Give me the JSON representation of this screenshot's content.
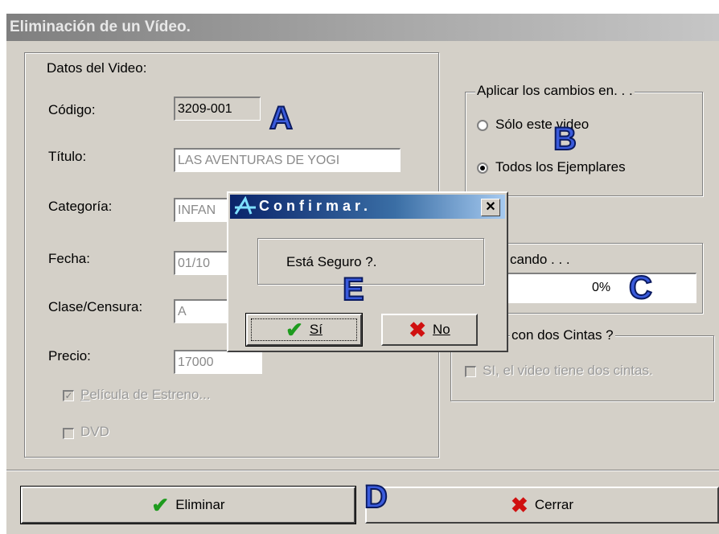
{
  "window": {
    "title": "Eliminación de un Vídeo."
  },
  "video_group": {
    "heading": "Datos del Video:",
    "codigo_label": "Código:",
    "codigo_value": "3209-001",
    "titulo_label": "Título:",
    "titulo_value": "LAS AVENTURAS DE YOGI",
    "categoria_label": "Categoría:",
    "categoria_value": "INFAN",
    "fecha_label": "Fecha:",
    "fecha_value": "01/10",
    "clase_label": "Clase/Censura:",
    "clase_value": "A",
    "precio_label": "Precio:",
    "precio_value": "17000",
    "estreno_label": "Película de Estreno...",
    "estreno_checked": true,
    "dvd_label": "DVD",
    "dvd_checked": false
  },
  "apply_group": {
    "legend": "Aplicar los cambios en. . .",
    "option1": "Sólo este video",
    "option2": "Todos los Ejemplares",
    "selected": "option2"
  },
  "progress_group": {
    "legend": "cando . . .",
    "percent_text": "0%",
    "percent": 0
  },
  "tapes_group": {
    "legend": "con dos Cintas ?",
    "checkbox_label": "SI, el video tiene dos cintas."
  },
  "buttons": {
    "delete": "Eliminar",
    "close": "Cerrar"
  },
  "dialog": {
    "title": "Confirmar.",
    "message": "Está Seguro ?.",
    "yes": "Sí",
    "no": "No",
    "close_glyph": "✕"
  },
  "markers": {
    "a": "A",
    "b": "B",
    "c": "C",
    "d": "D",
    "e": "E"
  },
  "icons": {
    "check": "✔",
    "cross": "✖"
  },
  "colors": {
    "marker": "#3a5bdc",
    "dialog_title": "#0a246a",
    "check": "#1e9b1e",
    "cross": "#d01010"
  }
}
